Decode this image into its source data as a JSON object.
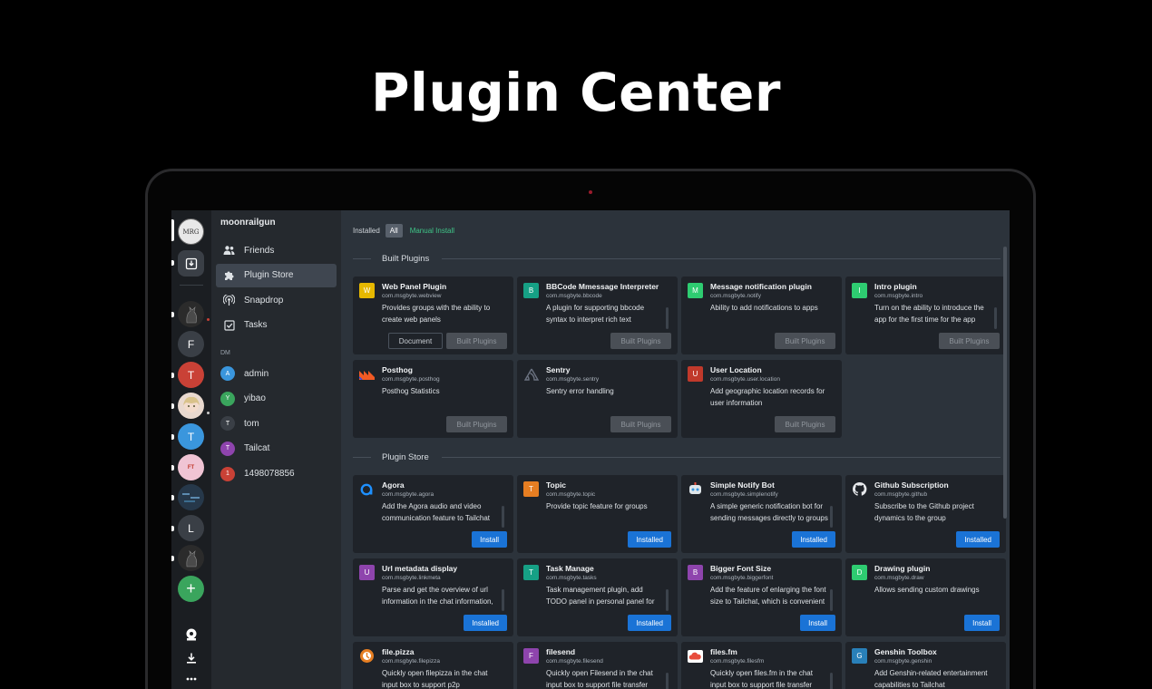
{
  "hero": {
    "title": "Plugin Center"
  },
  "workspace": {
    "name": "moonrailgun"
  },
  "rail": {
    "items": [
      {
        "letter": "F",
        "color": "#3a3f46"
      },
      {
        "letter": "T",
        "color": "#c94136"
      },
      {
        "letter": "T",
        "color": "#3a96dd"
      },
      {
        "letter": "L",
        "color": "#3a3f46"
      }
    ],
    "add_label": "+"
  },
  "nav": {
    "items": [
      {
        "label": "Friends",
        "icon": "users-icon"
      },
      {
        "label": "Plugin Store",
        "icon": "puzzle-icon"
      },
      {
        "label": "Snapdrop",
        "icon": "broadcast-icon"
      },
      {
        "label": "Tasks",
        "icon": "checkbox-icon"
      }
    ],
    "dm_label": "DM",
    "dms": [
      {
        "name": "admin",
        "initial": "A",
        "color": "#3a96dd"
      },
      {
        "name": "yibao",
        "initial": "Y",
        "color": "#3aa55d"
      },
      {
        "name": "tom",
        "initial": "T",
        "color": "#3a3f46"
      },
      {
        "name": "Tailcat",
        "initial": "T",
        "color": "#8e44ad"
      },
      {
        "name": "1498078856",
        "initial": "1",
        "color": "#c94136"
      }
    ]
  },
  "filters": {
    "label": "Installed",
    "all": "All",
    "manual": "Manual Install"
  },
  "sections": {
    "builtin": "Built Plugins",
    "store": "Plugin Store"
  },
  "builtin_plugins": [
    {
      "name": "Web Panel Plugin",
      "id": "com.msgbyte.webview",
      "desc": "Provides groups with the ability to create web panels",
      "icon": "W",
      "icon_color": "#e6b800",
      "doc": "Document",
      "action": "Built Plugins"
    },
    {
      "name": "BBCode Mmessage Interpreter",
      "id": "com.msgbyte.bbcode",
      "desc": "A plugin for supporting bbcode syntax to interpret rich text messages",
      "icon": "B",
      "icon_color": "#16a085",
      "action": "Built Plugins"
    },
    {
      "name": "Message notification plugin",
      "id": "com.msgbyte.notify",
      "desc": "Ability to add notifications to apps",
      "icon": "M",
      "icon_color": "#2ecc71",
      "action": "Built Plugins"
    },
    {
      "name": "Intro plugin",
      "id": "com.msgbyte.intro",
      "desc": "Turn on the ability to introduce the app for the first time for the app",
      "icon": "I",
      "icon_color": "#2ecc71",
      "action": "Built Plugins"
    },
    {
      "name": "Posthog",
      "id": "com.msgbyte.posthog",
      "desc": "Posthog Statistics",
      "icon": "posthog-icon",
      "icon_color": "#f15a24",
      "action": "Built Plugins"
    },
    {
      "name": "Sentry",
      "id": "com.msgbyte.sentry",
      "desc": "Sentry error handling",
      "icon": "sentry-icon",
      "icon_color": "#1f2329",
      "action": "Built Plugins"
    },
    {
      "name": "User Location",
      "id": "com.msgbyte.user.location",
      "desc": "Add geographic location records for user information",
      "icon": "U",
      "icon_color": "#c0392b",
      "action": "Built Plugins"
    }
  ],
  "store_plugins": [
    {
      "name": "Agora",
      "id": "com.msgbyte.agora",
      "desc": "Add the Agora audio and video communication feature to Tailchat",
      "icon": "agora-icon",
      "icon_color": "#1f2329",
      "action": "Install"
    },
    {
      "name": "Topic",
      "id": "com.msgbyte.topic",
      "desc": "Provide topic feature for groups",
      "icon": "T",
      "icon_color": "#e67e22",
      "action": "Installed"
    },
    {
      "name": "Simple Notify Bot",
      "id": "com.msgbyte.simplenotify",
      "desc": "A simple generic notification bot for sending messages directly to groups",
      "icon": "robot-icon",
      "icon_color": "#ecf0f1",
      "action": "Installed"
    },
    {
      "name": "Github Subscription",
      "id": "com.msgbyte.github",
      "desc": "Subscribe to the Github project dynamics to the group",
      "icon": "github-icon",
      "icon_color": "#1f2329",
      "action": "Installed"
    },
    {
      "name": "Url metadata display",
      "id": "com.msgbyte.linkmeta",
      "desc": "Parse and get the overview of url information in the chat information, such as",
      "icon": "U",
      "icon_color": "#8e44ad",
      "action": "Installed"
    },
    {
      "name": "Task Manage",
      "id": "com.msgbyte.tasks",
      "desc": "Task management plugin, add TODO panel in personal panel for personal todo management",
      "icon": "T",
      "icon_color": "#16a085",
      "action": "Installed"
    },
    {
      "name": "Bigger Font Size",
      "id": "com.msgbyte.biggerfont",
      "desc": "Add the feature of enlarging the font size to Tailchat, which is convenient for different user",
      "icon": "B",
      "icon_color": "#8e44ad",
      "action": "Install"
    },
    {
      "name": "Drawing plugin",
      "id": "com.msgbyte.draw",
      "desc": "Allows sending custom drawings",
      "icon": "D",
      "icon_color": "#2ecc71",
      "action": "Install"
    },
    {
      "name": "file.pizza",
      "id": "com.msgbyte.filepizza",
      "desc": "Quickly open filepizza in the chat input box to support p2p",
      "icon": "pizza-icon",
      "icon_color": "#e67e22",
      "action": ""
    },
    {
      "name": "filesend",
      "id": "com.msgbyte.filesend",
      "desc": "Quickly open Filesend in the chat input box to support file transfer",
      "icon": "F",
      "icon_color": "#8e44ad",
      "action": ""
    },
    {
      "name": "files.fm",
      "id": "com.msgbyte.filesfm",
      "desc": "Quickly open files.fm in the chat input box to support file transfer",
      "icon": "cloud-icon",
      "icon_color": "#e74c3c",
      "action": ""
    },
    {
      "name": "Genshin Toolbox",
      "id": "com.msgbyte.genshin",
      "desc": "Add Genshin-related entertainment capabilities to Tailchat",
      "icon": "G",
      "icon_color": "#2980b9",
      "action": ""
    }
  ]
}
